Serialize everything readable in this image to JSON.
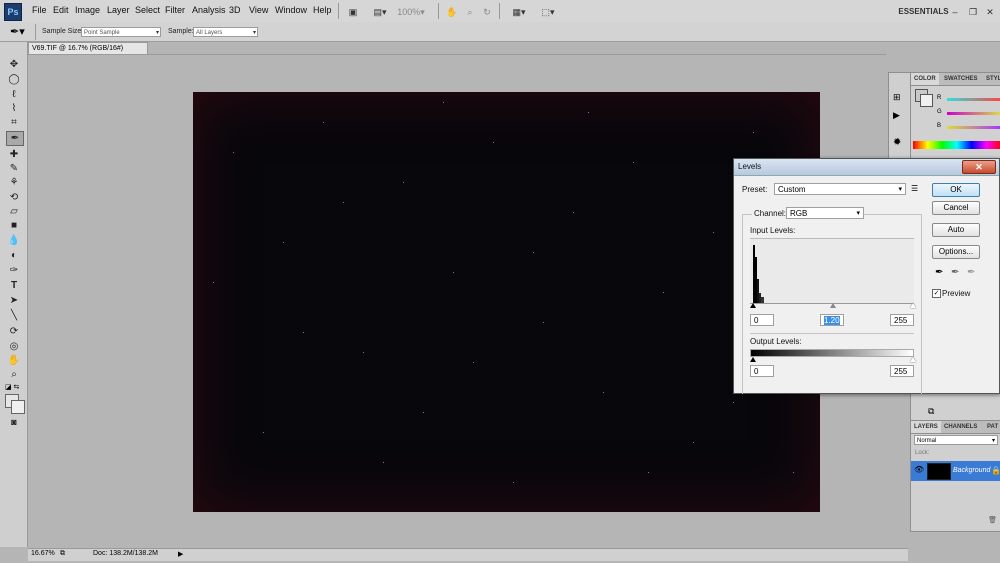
{
  "app": {
    "logo": "Ps"
  },
  "menu": [
    "File",
    "Edit",
    "Image",
    "Layer",
    "Select",
    "Filter",
    "Analysis",
    "3D",
    "View",
    "Window",
    "Help"
  ],
  "appbar": {
    "zoom": "100%",
    "workspace": "ESSENTIALS ▾",
    "min": "–",
    "restore": "❐",
    "close": "✕"
  },
  "options": {
    "sample_size_label": "Sample Size:",
    "sample_size_value": "Point Sample",
    "sample_label": "Sample:",
    "sample_value": "All Layers"
  },
  "document": {
    "tab_title": "V69.TIF @ 16.7% (RGB/16#)"
  },
  "status": {
    "zoom": "16.67%",
    "doc": "Doc: 138.2M/138.2M"
  },
  "color_panel": {
    "tabs": [
      "COLOR",
      "SWATCHES",
      "STYL"
    ],
    "channels": [
      "R",
      "G",
      "B"
    ]
  },
  "layers_panel": {
    "tabs": [
      "LAYERS",
      "CHANNELS",
      "PAT"
    ],
    "blend_mode": "Normal",
    "lock_label": "Lock:",
    "layer_name": "Background"
  },
  "levels": {
    "title": "Levels",
    "preset_label": "Preset:",
    "preset_value": "Custom",
    "channel_label": "Channel:",
    "channel_value": "RGB",
    "input_label": "Input Levels:",
    "input_black": "0",
    "input_gamma": "1.20",
    "input_white": "255",
    "output_label": "Output Levels:",
    "output_black": "0",
    "output_white": "255",
    "ok": "OK",
    "cancel": "Cancel",
    "auto": "Auto",
    "options": "Options...",
    "preview_label": "Preview",
    "preview_checked": true,
    "gamma_fraction": 0.5
  }
}
